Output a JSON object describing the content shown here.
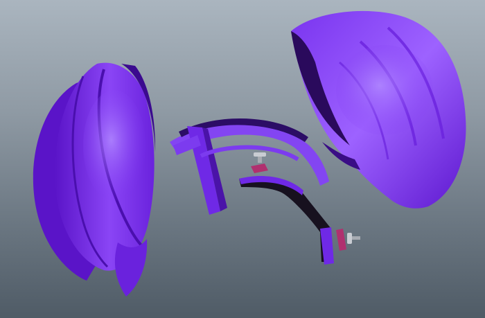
{
  "viewport": {
    "background_top": "#aab5bf",
    "background_bottom": "#4f5b66"
  },
  "colors": {
    "purple_light": "#9b5cff",
    "purple_mid": "#7b2ff2",
    "purple_dark": "#4f10b5",
    "dark_part": "#17111f",
    "magenta_part": "#b0306f",
    "metal": "#c9ccd2"
  },
  "parts": [
    "left-shell",
    "right-shell",
    "headband-frame",
    "hinge-arm",
    "clip-pad-top",
    "clip-pad-bottom",
    "screw-top",
    "screw-bottom"
  ]
}
